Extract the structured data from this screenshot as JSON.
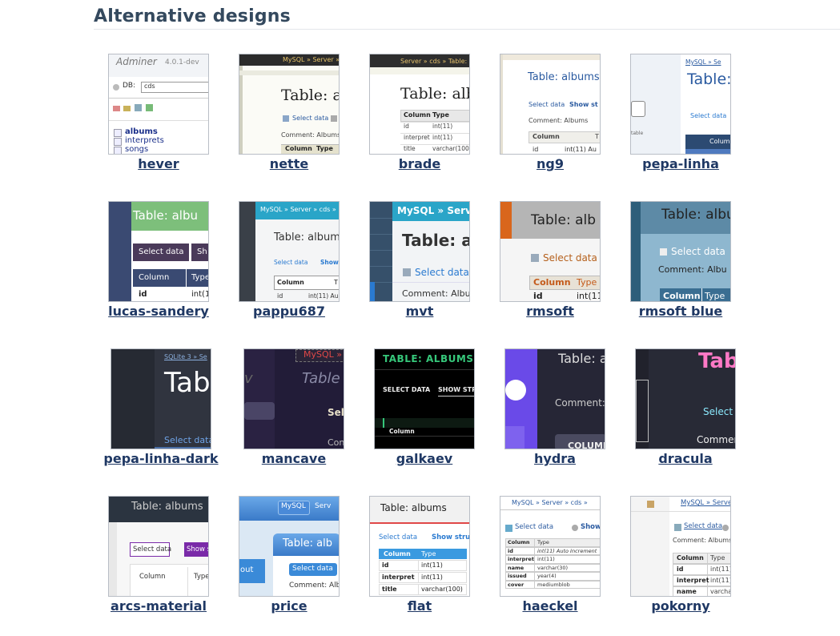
{
  "heading": "Alternative designs",
  "designs": [
    {
      "name": "hever",
      "lines": [
        "Adminer",
        "4.0.1-dev",
        "DB:",
        "cds",
        "albums",
        "interprets",
        "songs"
      ]
    },
    {
      "name": "nette",
      "lines": [
        "MySQL » Server »",
        "Table: al",
        "Select data",
        "Comment: Albums",
        "Column",
        "Type"
      ]
    },
    {
      "name": "brade",
      "lines": [
        "Server » cds » Table: all",
        "Table: alb",
        "Column",
        "Type",
        "id",
        "int(11)",
        "interpret",
        "int(11)",
        "title",
        "varchar(100)"
      ]
    },
    {
      "name": "ng9",
      "lines": [
        "Table: albums",
        "Select data",
        "Show st",
        "Comment: Albums",
        "Column",
        "T",
        "id",
        "int(11) Au"
      ]
    },
    {
      "name": "pepa-linha",
      "lines": [
        "MySQL » Se",
        "Table:",
        "Select data",
        "Colum",
        "table"
      ]
    },
    {
      "name": "lucas-sandery",
      "lines": [
        "Table: albu",
        "Select data",
        "Sh",
        "Column",
        "Type",
        "id",
        "int(1"
      ]
    },
    {
      "name": "pappu687",
      "lines": [
        "MySQL » Server » cds »",
        "Table: album",
        "Select data",
        "Show",
        "Column",
        "T",
        "id",
        "int(11) Au"
      ]
    },
    {
      "name": "mvt",
      "lines": [
        "MySQL » Serv",
        "Table: a",
        "Select data",
        "Comment: Albu"
      ]
    },
    {
      "name": "rmsoft",
      "lines": [
        "Table: alb",
        "Select data",
        "Column",
        "Type",
        "id",
        "int(11"
      ]
    },
    {
      "name": "rmsoft blue",
      "lines": [
        "Table: albu",
        "Select data",
        "Comment: Albu",
        "Column",
        "Type"
      ]
    },
    {
      "name": "pepa-linha-dark",
      "lines": [
        "SQLite 3 » Se",
        "Tab",
        "Select data"
      ]
    },
    {
      "name": "mancave",
      "lines": [
        "MySQL »",
        "Table",
        "Sel",
        "Con",
        "v"
      ]
    },
    {
      "name": "galkaev",
      "lines": [
        "TABLE: ALBUMS",
        "SELECT DATA",
        "SHOW STRU",
        "Column"
      ]
    },
    {
      "name": "hydra",
      "lines": [
        "Table: a",
        "Comment:",
        "COLUMN"
      ]
    },
    {
      "name": "dracula",
      "lines": [
        "Tab",
        "Select d",
        "Comment"
      ]
    },
    {
      "name": "arcs-material",
      "lines": [
        "Table: albums",
        "Select data",
        "Show s",
        "Column",
        "Type"
      ]
    },
    {
      "name": "price",
      "lines": [
        "MySQL",
        "Serv",
        "Table: alb",
        "Select data",
        "Comment: Alb",
        "out"
      ]
    },
    {
      "name": "flat",
      "lines": [
        "Table: albums",
        "Select data",
        "Show stru",
        "Column",
        "Type",
        "id",
        "int(11)",
        "interpret",
        "int(11)",
        "title",
        "varchar(100)"
      ]
    },
    {
      "name": "haeckel",
      "lines": [
        "MySQL » Server » cds »",
        "Select data",
        "Show",
        "Column",
        "Type",
        "id",
        "int(11) Auto Increment",
        "interpret",
        "int(11)",
        "name",
        "varchar(30)",
        "issued",
        "year(4)",
        "cover",
        "mediumblob"
      ]
    },
    {
      "name": "pokorny",
      "lines": [
        "MySQL » Server",
        "Select data",
        "Comment: Albums",
        "Column",
        "Type",
        "id",
        "int(11)",
        "interpret",
        "int(11)",
        "name",
        "varchar"
      ]
    }
  ]
}
